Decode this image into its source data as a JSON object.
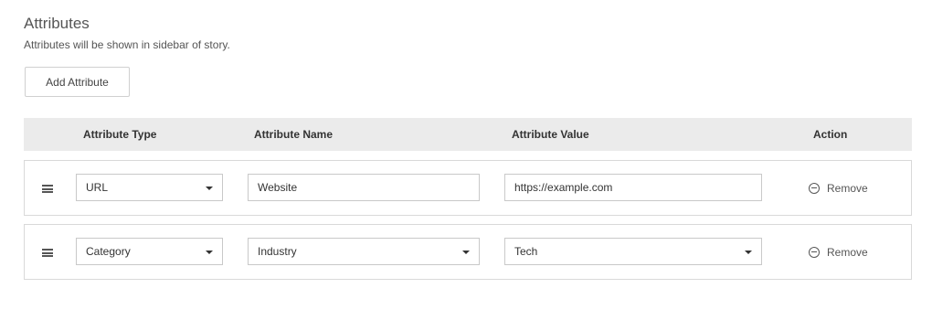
{
  "section": {
    "title": "Attributes",
    "subtitle": "Attributes will be shown in sidebar of story.",
    "add_button_label": "Add Attribute"
  },
  "table": {
    "headers": {
      "type": "Attribute Type",
      "name": "Attribute Name",
      "value": "Attribute Value",
      "action": "Action"
    },
    "rows": [
      {
        "type": "URL",
        "name": "Website",
        "value": "https://example.com",
        "action_label": "Remove",
        "name_control": "input",
        "value_control": "input"
      },
      {
        "type": "Category",
        "name": "Industry",
        "value": "Tech",
        "action_label": "Remove",
        "name_control": "select",
        "value_control": "select"
      }
    ]
  },
  "icons": {
    "drag": "drag-handle-icon",
    "caret": "caret-down-icon",
    "remove": "minus-circle-icon"
  }
}
